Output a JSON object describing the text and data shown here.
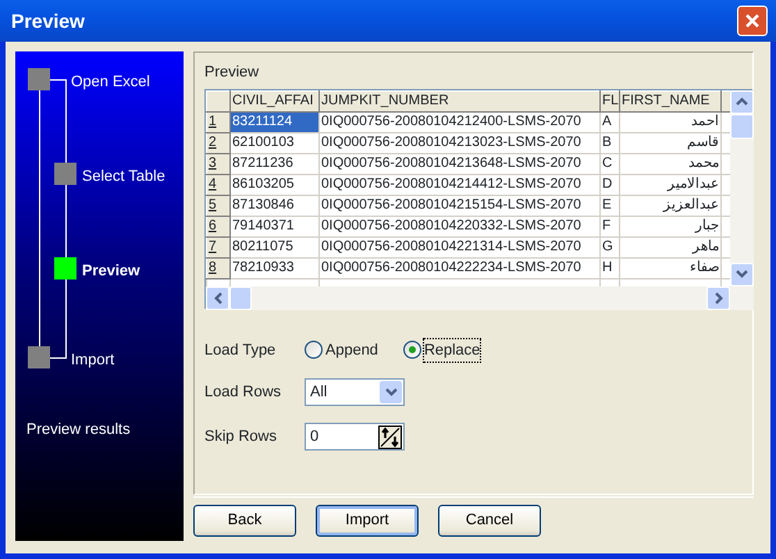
{
  "window": {
    "title": "Preview"
  },
  "wizard": {
    "steps": [
      {
        "label": "Open Excel",
        "selected": false,
        "children": [
          {
            "label": "Select Table",
            "selected": false
          },
          {
            "label": "Preview",
            "selected": true
          }
        ]
      },
      {
        "label": "Import",
        "selected": false
      }
    ],
    "caption": "Preview results"
  },
  "preview": {
    "title": "Preview",
    "table": {
      "columns": [
        "CIVIL_AFFAI",
        "JUMPKIT_NUMBER",
        "FL",
        "FIRST_NAME"
      ],
      "rows": [
        {
          "number": "1",
          "selected": true,
          "cells": [
            "83211124",
            "0IQ000756-20080104212400-LSMS-2070",
            "A",
            "احمد"
          ]
        },
        {
          "number": "2",
          "selected": false,
          "cells": [
            "62100103",
            "0IQ000756-20080104213023-LSMS-2070",
            "B",
            "قاسم"
          ]
        },
        {
          "number": "3",
          "selected": false,
          "cells": [
            "87211236",
            "0IQ000756-20080104213648-LSMS-2070",
            "C",
            "محمد"
          ]
        },
        {
          "number": "4",
          "selected": false,
          "cells": [
            "86103205",
            "0IQ000756-20080104214412-LSMS-2070",
            "D",
            "عبدالامير"
          ]
        },
        {
          "number": "5",
          "selected": false,
          "cells": [
            "87130846",
            "0IQ000756-20080104215154-LSMS-2070",
            "E",
            "عبدالعزيز"
          ]
        },
        {
          "number": "6",
          "selected": false,
          "cells": [
            "79140371",
            "0IQ000756-20080104220332-LSMS-2070",
            "F",
            "جبار"
          ]
        },
        {
          "number": "7",
          "selected": false,
          "cells": [
            "80211075",
            "0IQ000756-20080104221314-LSMS-2070",
            "G",
            "ماهر"
          ]
        },
        {
          "number": "8",
          "selected": false,
          "cells": [
            "78210933",
            "0IQ000756-20080104222234-LSMS-2070",
            "H",
            "صفاء"
          ]
        }
      ]
    }
  },
  "options": {
    "load_type": {
      "label": "Load Type",
      "choices": [
        {
          "label": "Append",
          "selected": false
        },
        {
          "label": "Replace",
          "selected": true
        }
      ]
    },
    "load_rows": {
      "label": "Load Rows",
      "value": "All"
    },
    "skip_rows": {
      "label": "Skip Rows",
      "value": "0"
    }
  },
  "buttons": [
    {
      "label": "Back",
      "default": false
    },
    {
      "label": "Import",
      "default": true
    },
    {
      "label": "Cancel",
      "default": false
    }
  ]
}
